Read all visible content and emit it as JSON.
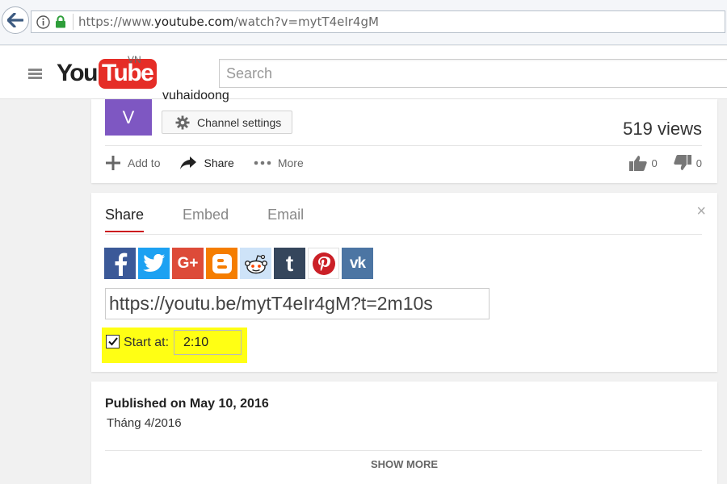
{
  "browser": {
    "url_prefix": "https://www.",
    "url_domain": "youtube.com",
    "url_path": "/watch?v=mytT4eIr4gM"
  },
  "header": {
    "logo_you": "You",
    "logo_tube": "Tube",
    "region": "VN",
    "search_placeholder": "Search"
  },
  "video_info": {
    "avatar_letter": "V",
    "channel_name": "vuhaidoong",
    "channel_settings_label": "Channel settings",
    "views": "519 views",
    "actions": {
      "add_to": "Add to",
      "share": "Share",
      "more": "More"
    },
    "likes": "0",
    "dislikes": "0"
  },
  "share_panel": {
    "close": "×",
    "tabs": [
      "Share",
      "Embed",
      "Email"
    ],
    "active_tab": "Share",
    "social": [
      {
        "name": "facebook",
        "glyph": "f",
        "color": "#3b5998"
      },
      {
        "name": "twitter",
        "glyph": "t",
        "color": "#1da1f2"
      },
      {
        "name": "google-plus",
        "glyph": "G+",
        "color": "#dd4b39"
      },
      {
        "name": "blogger",
        "glyph": "B",
        "color": "#f57d00"
      },
      {
        "name": "reddit",
        "glyph": "r",
        "color": "#cee3f8"
      },
      {
        "name": "tumblr",
        "glyph": "t",
        "color": "#35465c"
      },
      {
        "name": "pinterest",
        "glyph": "P",
        "color": "#ffffff"
      },
      {
        "name": "vk",
        "glyph": "vk",
        "color": "#4c75a3"
      }
    ],
    "short_link": "https://youtu.be/mytT4eIr4gM?t=2m10s",
    "start_at_label": "Start at:",
    "start_at_value": "2:10",
    "start_at_checked": true,
    "highlight_color": "#ffff14"
  },
  "description": {
    "published": "Published on May 10, 2016",
    "text": "Tháng 4/2016",
    "show_more": "SHOW MORE"
  }
}
